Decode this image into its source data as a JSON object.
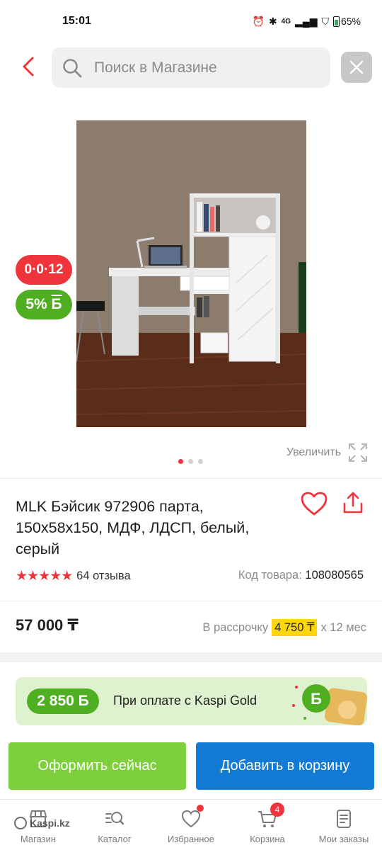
{
  "status_bar": {
    "time": "15:01",
    "network": "4G",
    "battery": "65%"
  },
  "search": {
    "placeholder": "Поиск в Магазине"
  },
  "badges": {
    "installment": "0·0·12",
    "bonus_percent": "5%",
    "bonus_currency": "Б"
  },
  "gallery": {
    "zoom_label": "Увеличить",
    "page_count": 3,
    "current_page": 1
  },
  "product": {
    "title": "MLK Бэйсик 972906 парта, 150х58х150, МДФ, ЛДСП, белый, серый",
    "rating": 5,
    "reviews": "64 отзыва",
    "code_label": "Код товара:",
    "code_value": "108080565",
    "price": "57 000 ₸",
    "installment_label": "В рассрочку",
    "installment_monthly": "4 750 ₸",
    "installment_term": "х 12 мес"
  },
  "kaspi_gold": {
    "bonus": "2 850 Б",
    "text": "При оплате с Kaspi Gold"
  },
  "actions": {
    "checkout": "Оформить сейчас",
    "add_to_cart": "Добавить в корзину"
  },
  "nav": {
    "items": [
      {
        "label": "Магазин",
        "icon": "store-icon"
      },
      {
        "label": "Каталог",
        "icon": "catalog-icon"
      },
      {
        "label": "Избранное",
        "icon": "heart-icon"
      },
      {
        "label": "Корзина",
        "icon": "cart-icon",
        "count": "4"
      },
      {
        "label": "Мои заказы",
        "icon": "orders-icon"
      }
    ]
  },
  "watermark": "Kaspi.kz",
  "colors": {
    "accent_red": "#f0343c",
    "bonus_green": "#4fae21",
    "checkout_green": "#7dcf3b",
    "cart_blue": "#137ad6",
    "highlight_yellow": "#ffd60a"
  }
}
